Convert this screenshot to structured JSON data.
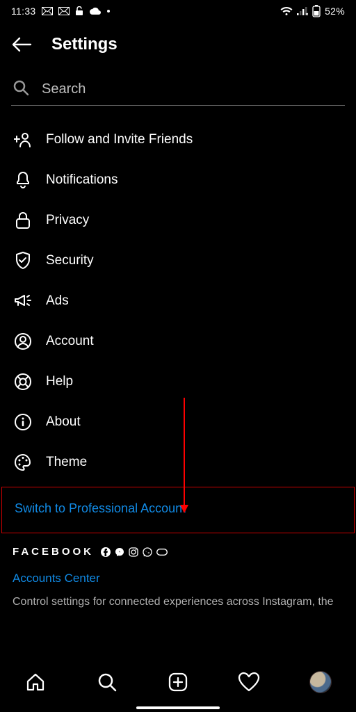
{
  "status": {
    "time": "11:33",
    "battery_pct": "52%"
  },
  "header": {
    "title": "Settings"
  },
  "search": {
    "placeholder": "Search"
  },
  "menu": {
    "follow": "Follow and Invite Friends",
    "notifications": "Notifications",
    "privacy": "Privacy",
    "security": "Security",
    "ads": "Ads",
    "account": "Account",
    "help": "Help",
    "about": "About",
    "theme": "Theme"
  },
  "switch_link": "Switch to Professional Account",
  "fb": {
    "brand": "FACEBOOK",
    "accounts": "Accounts Center",
    "desc": "Control settings for connected experiences across Instagram, the"
  }
}
